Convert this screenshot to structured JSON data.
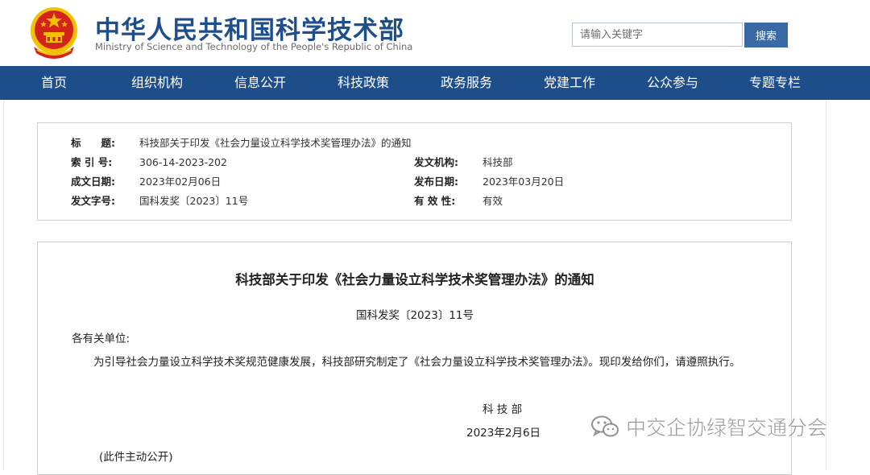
{
  "header": {
    "title": "中华人民共和国科学技术部",
    "subtitle": "Ministry of Science and Technology of the People's Republic of China",
    "search": {
      "placeholder": "请输入关键字",
      "button_label": "搜索"
    }
  },
  "nav": {
    "items": [
      "首页",
      "组织机构",
      "信息公开",
      "科技政策",
      "政务服务",
      "党建工作",
      "公众参与",
      "专题专栏"
    ]
  },
  "meta": {
    "title_label": "标　　题:",
    "title_value": "科技部关于印发《社会力量设立科学技术奖管理办法》的通知",
    "index_label": "索 引 号:",
    "index_value": "306-14-2023-202",
    "issuer_label": "发文机构:",
    "issuer_value": "科技部",
    "created_label": "成文日期:",
    "created_value": "2023年02月06日",
    "published_label": "发布日期:",
    "published_value": "2023年03月20日",
    "docno_label": "发文字号:",
    "docno_value": "国科发奖〔2023〕11号",
    "validity_label": "有 效 性:",
    "validity_value": "有效"
  },
  "document": {
    "title": "科技部关于印发《社会力量设立科学技术奖管理办法》的通知",
    "number": "国科发奖〔2023〕11号",
    "salutation": "各有关单位:",
    "body": "为引导社会力量设立科学技术奖规范健康发展，科技部研究制定了《社会力量设立科学技术奖管理办法》。现印发给你们，请遵照执行。",
    "signature": "科 技 部",
    "date": "2023年2月6日",
    "note": "(此件主动公开)"
  },
  "watermark": {
    "text": "中交企协绿智交通分会",
    "icon": "wechat-icon"
  },
  "colors": {
    "brand_blue": "#1d4e89",
    "title_blue": "#1f4f8b",
    "search_button": "#3a6aa5",
    "emblem_red": "#d4231b",
    "emblem_gold": "#f2c200"
  }
}
